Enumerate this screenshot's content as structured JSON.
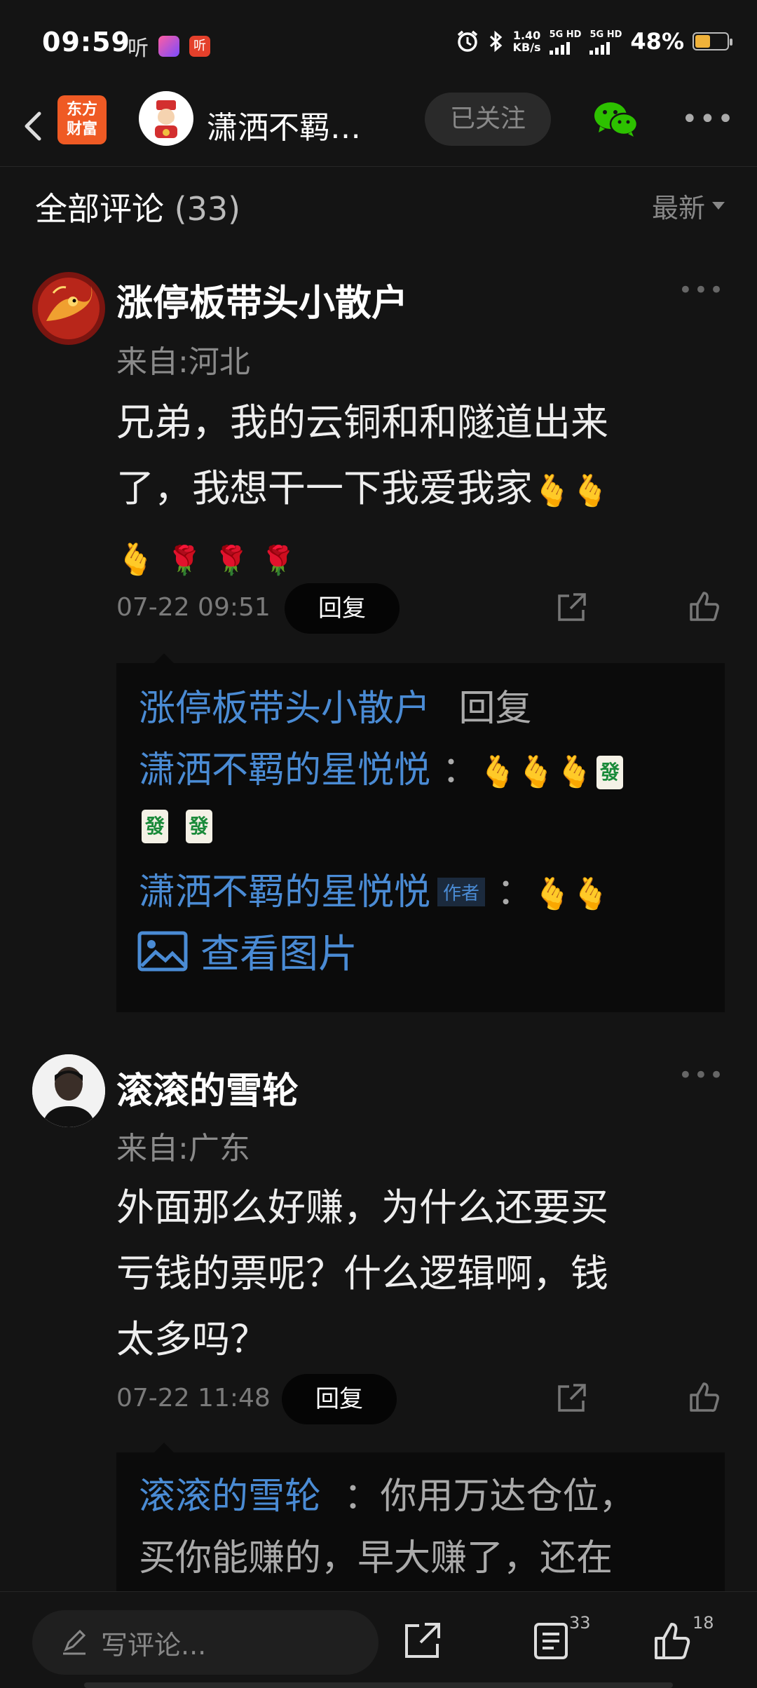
{
  "status_bar": {
    "time": "09:59",
    "listen_icon": "听",
    "app_badge": "听",
    "network_speed_top": "1.40",
    "network_speed_bottom": "KB/s",
    "sim1": "5G HD",
    "sim2": "5G HD",
    "battery_percent": "48%",
    "battery_level": 0.48
  },
  "nav": {
    "logo_text_line1": "东方",
    "logo_text_line2": "财富",
    "title": "潇洒不羁…",
    "follow_label": "已关注"
  },
  "comments_header": {
    "title": "全部评论",
    "count": "(33)",
    "sort_label": "最新"
  },
  "comments": [
    {
      "username": "涨停板带头小散户",
      "location": "来自:河北",
      "content_line1": "兄弟，我的云铜和和隧道出来",
      "content_line2": "了，我想干一下我爱我家",
      "time": "07-22 09:51",
      "reply_label": "回复",
      "replies": {
        "to_user": "涨停板带头小散户",
        "to_word": "回复",
        "r1_user": "潇洒不羁的星悦悦",
        "r2_user": "潇洒不羁的星悦悦",
        "r2_badge": "作者",
        "view_image": "查看图片"
      }
    },
    {
      "username": "滚滚的雪轮",
      "location": "来自:广东",
      "content_line1": "外面那么好赚，为什么还要买",
      "content_line2": "亏钱的票呢？什么逻辑啊，钱",
      "content_line3": "太多吗？",
      "time": "07-22 11:48",
      "reply_label": "回复",
      "replies": {
        "r1_user": "滚滚的雪轮",
        "r1_text_line1": "：你用万达仓位，",
        "r1_text_line2": "买你能赚的，早大赚了，还在"
      }
    }
  ],
  "emoji": {
    "hand": "🫰",
    "rose": "🌹",
    "mahjong": "發"
  },
  "bottom_bar": {
    "comment_placeholder": "写评论...",
    "comment_count": "33",
    "like_count": "18"
  },
  "colors": {
    "background": "#141414",
    "link_blue": "#4a8bd4",
    "brand_orange": "#ef5a24",
    "wechat_green": "#2dc100"
  }
}
